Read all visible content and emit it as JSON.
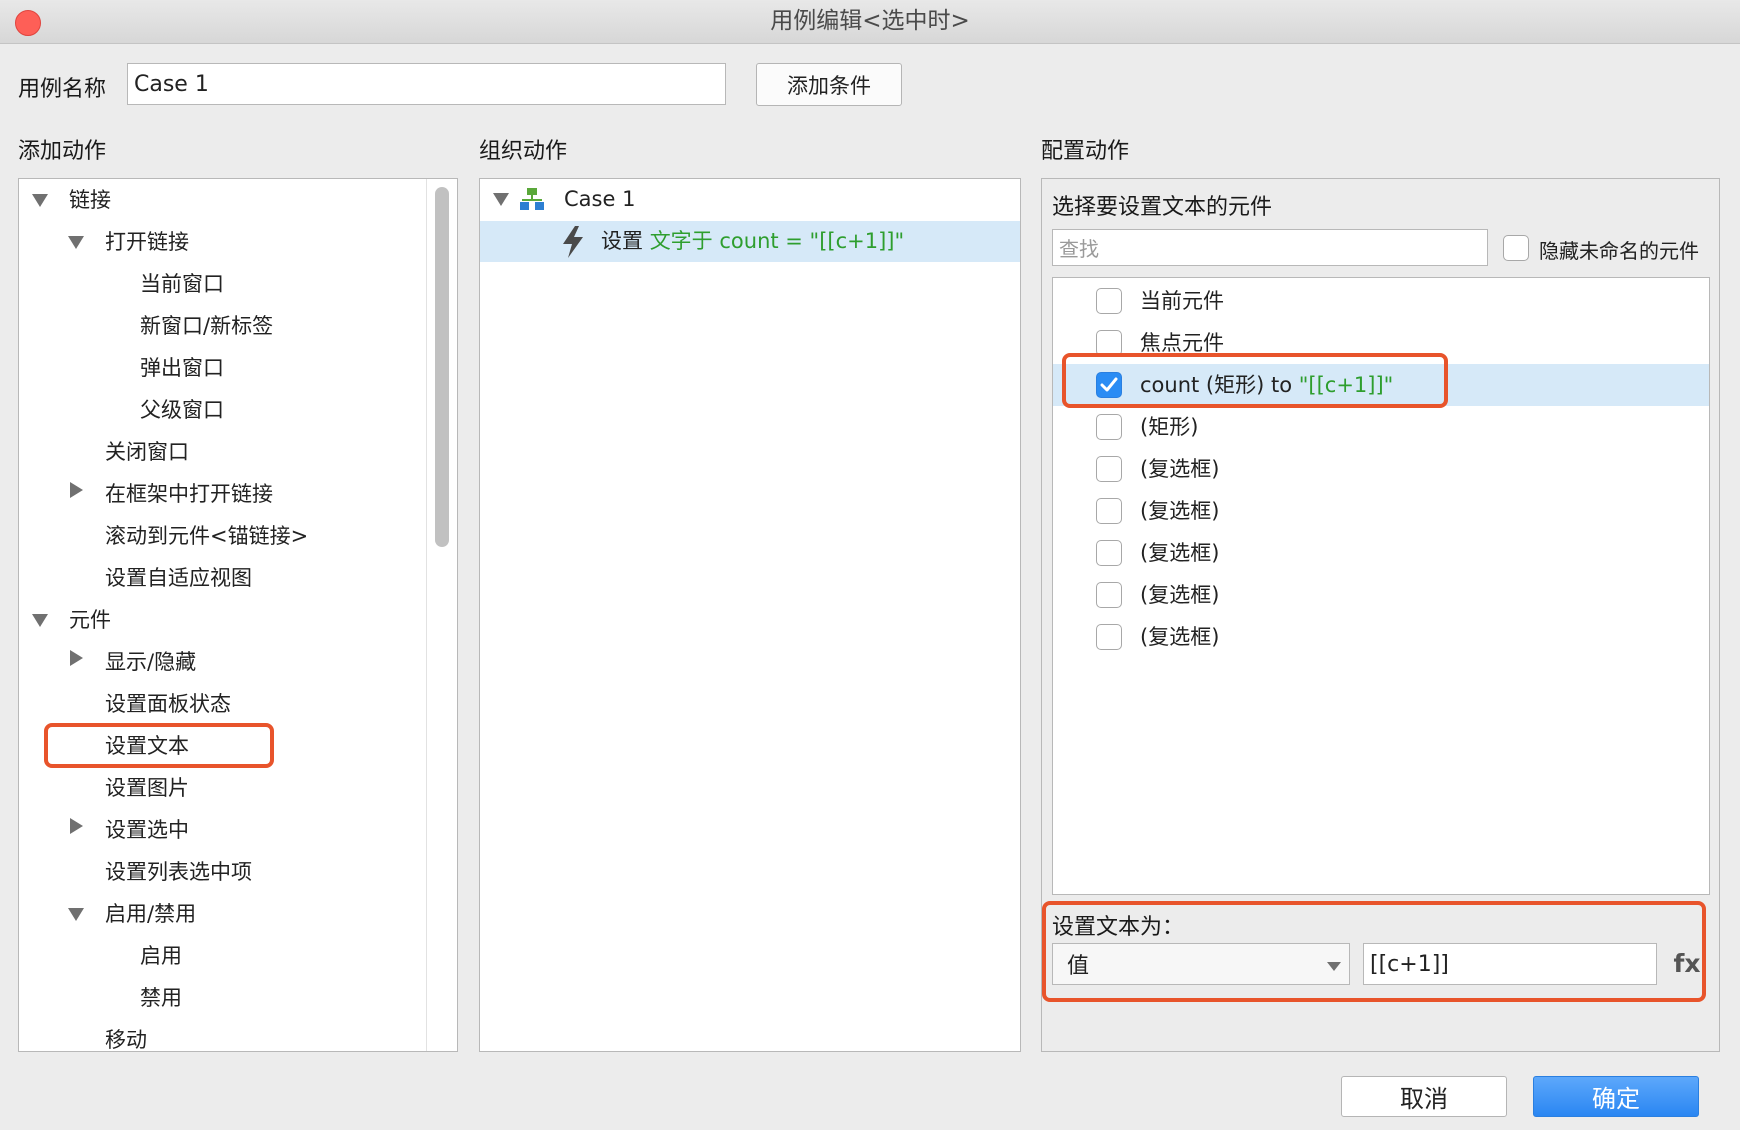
{
  "window": {
    "title": "用例编辑<选中时>"
  },
  "case_name": {
    "label": "用例名称",
    "value": "Case 1",
    "add_condition": "添加条件"
  },
  "add_actions": {
    "heading": "添加动作",
    "items": [
      {
        "label": "链接"
      },
      {
        "label": "打开链接"
      },
      {
        "label": "当前窗口"
      },
      {
        "label": "新窗口/新标签"
      },
      {
        "label": "弹出窗口"
      },
      {
        "label": "父级窗口"
      },
      {
        "label": "关闭窗口"
      },
      {
        "label": "在框架中打开链接"
      },
      {
        "label": "滚动到元件<锚链接>"
      },
      {
        "label": "设置自适应视图"
      },
      {
        "label": "元件"
      },
      {
        "label": "显示/隐藏"
      },
      {
        "label": "设置面板状态"
      },
      {
        "label": "设置文本"
      },
      {
        "label": "设置图片"
      },
      {
        "label": "设置选中"
      },
      {
        "label": "设置列表选中项"
      },
      {
        "label": "启用/禁用"
      },
      {
        "label": "启用"
      },
      {
        "label": "禁用"
      },
      {
        "label": "移动"
      }
    ]
  },
  "organize_actions": {
    "heading": "组织动作",
    "case_label": "Case 1",
    "action_prefix": "设置",
    "action_detail": "文字于 count = \"[[c+1]]\""
  },
  "configure_actions": {
    "heading": "配置动作",
    "select_title": "选择要设置文本的元件",
    "search_placeholder": "查找",
    "hide_unnamed": "隐藏未命名的元件",
    "widgets": [
      {
        "label": "当前元件",
        "checked": false
      },
      {
        "label": "焦点元件",
        "checked": false
      },
      {
        "label": "count (矩形) to ",
        "value": "\"[[c+1]]\"",
        "checked": true
      },
      {
        "label": "(矩形)",
        "checked": false
      },
      {
        "label": "(复选框)",
        "checked": false
      },
      {
        "label": "(复选框)",
        "checked": false
      },
      {
        "label": "(复选框)",
        "checked": false
      },
      {
        "label": "(复选框)",
        "checked": false
      },
      {
        "label": "(复选框)",
        "checked": false
      }
    ],
    "set_text_label": "设置文本为：",
    "type_select": "值",
    "value_input": "[[c+1]]",
    "fx": "fx"
  },
  "footer": {
    "cancel": "取消",
    "ok": "确定"
  },
  "colors": {
    "accent": "#2a8cf4",
    "highlight": "#e8542b",
    "green_text": "#2e9e2e",
    "selected_row": "#d6e9f8"
  }
}
